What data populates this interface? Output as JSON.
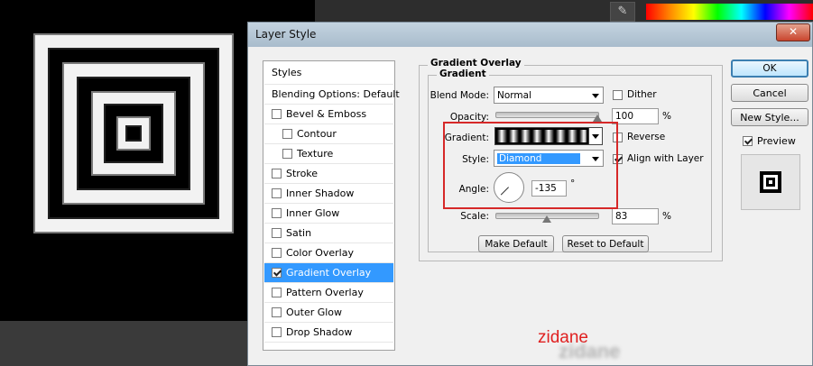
{
  "ps": {
    "tool_icon": "brush-tool-icon"
  },
  "dialog": {
    "title": "Layer Style",
    "close_glyph": "✕"
  },
  "styles_panel": {
    "header": "Styles",
    "blending": "Blending Options: Default",
    "items": [
      {
        "label": "Bevel & Emboss",
        "checked": false,
        "sub": false
      },
      {
        "label": "Contour",
        "checked": false,
        "sub": true
      },
      {
        "label": "Texture",
        "checked": false,
        "sub": true
      },
      {
        "label": "Stroke",
        "checked": false,
        "sub": false
      },
      {
        "label": "Inner Shadow",
        "checked": false,
        "sub": false
      },
      {
        "label": "Inner Glow",
        "checked": false,
        "sub": false
      },
      {
        "label": "Satin",
        "checked": false,
        "sub": false
      },
      {
        "label": "Color Overlay",
        "checked": false,
        "sub": false
      },
      {
        "label": "Gradient Overlay",
        "checked": true,
        "sub": false,
        "selected": true
      },
      {
        "label": "Pattern Overlay",
        "checked": false,
        "sub": false
      },
      {
        "label": "Outer Glow",
        "checked": false,
        "sub": false
      },
      {
        "label": "Drop Shadow",
        "checked": false,
        "sub": false
      }
    ]
  },
  "gradient_overlay": {
    "section_title": "Gradient Overlay",
    "group_title": "Gradient",
    "blend_mode_label": "Blend Mode:",
    "blend_mode_value": "Normal",
    "dither_label": "Dither",
    "dither_checked": false,
    "opacity_label": "Opacity:",
    "opacity_value": "100",
    "opacity_fraction": 1.0,
    "percent": "%",
    "gradient_label": "Gradient:",
    "reverse_label": "Reverse",
    "reverse_checked": false,
    "style_label": "Style:",
    "style_value": "Diamond",
    "align_label": "Align with Layer",
    "align_checked": true,
    "angle_label": "Angle:",
    "angle_value": "-135",
    "degree": "°",
    "scale_label": "Scale:",
    "scale_value": "83",
    "scale_fraction": 0.5,
    "make_default": "Make Default",
    "reset_default": "Reset to Default"
  },
  "right_panel": {
    "ok": "OK",
    "cancel": "Cancel",
    "new_style": "New Style...",
    "preview_label": "Preview",
    "preview_checked": true
  },
  "watermark": "zidane",
  "watermark_blur": "zidane",
  "colors": {
    "selection": "#3399ff",
    "highlight": "#d62828",
    "watermark": "#e02020"
  }
}
